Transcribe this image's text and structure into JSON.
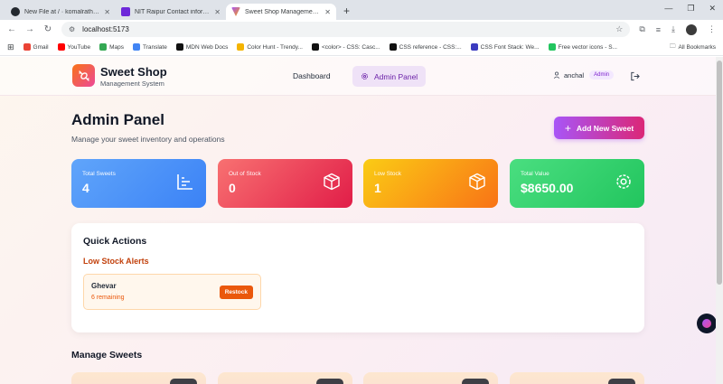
{
  "browser": {
    "tabs": [
      {
        "title": "New File at / · komalrathore05",
        "active": false,
        "color": "#24292f"
      },
      {
        "title": "NIT Raipur Contact information",
        "active": false,
        "color": "#6d28d9"
      },
      {
        "title": "Sweet Shop Management System",
        "active": true,
        "color": "#f59e0b"
      }
    ],
    "url": "localhost:5173",
    "bookmarks": [
      {
        "label": "Gmail",
        "color": "#ea4335"
      },
      {
        "label": "YouTube",
        "color": "#ff0000"
      },
      {
        "label": "Maps",
        "color": "#34a853"
      },
      {
        "label": "Translate",
        "color": "#4285f4"
      },
      {
        "label": "MDN Web Docs",
        "color": "#111111"
      },
      {
        "label": "Color Hunt - Trendy...",
        "color": "#f4b400"
      },
      {
        "label": "<color> - CSS: Casc...",
        "color": "#111111"
      },
      {
        "label": "CSS reference - CSS:...",
        "color": "#111111"
      },
      {
        "label": "CSS Font Stack: We...",
        "color": "#3b3bbf"
      },
      {
        "label": "Free vector icons - S...",
        "color": "#22c55e"
      }
    ],
    "all_bookmarks": "All Bookmarks"
  },
  "header": {
    "brand_name": "Sweet Shop",
    "brand_sub": "Management System",
    "nav_dashboard": "Dashboard",
    "nav_admin": "Admin Panel",
    "username": "anchal",
    "role": "Admin"
  },
  "main": {
    "title": "Admin Panel",
    "subtitle": "Manage your sweet inventory and operations",
    "add_button": "Add New Sweet",
    "stats": [
      {
        "label": "Total Sweets",
        "value": "4",
        "icon": "chart-icon"
      },
      {
        "label": "Out of Stock",
        "value": "0",
        "icon": "box-icon"
      },
      {
        "label": "Low Stock",
        "value": "1",
        "icon": "box-icon"
      },
      {
        "label": "Total Value",
        "value": "$8650.00",
        "icon": "gear-icon"
      }
    ],
    "quick_actions": {
      "title": "Quick Actions",
      "low_stock_title": "Low Stock Alerts",
      "alerts": [
        {
          "name": "Ghevar",
          "remaining": "6 remaining",
          "button": "Restock"
        }
      ]
    },
    "manage_title": "Manage Sweets"
  }
}
